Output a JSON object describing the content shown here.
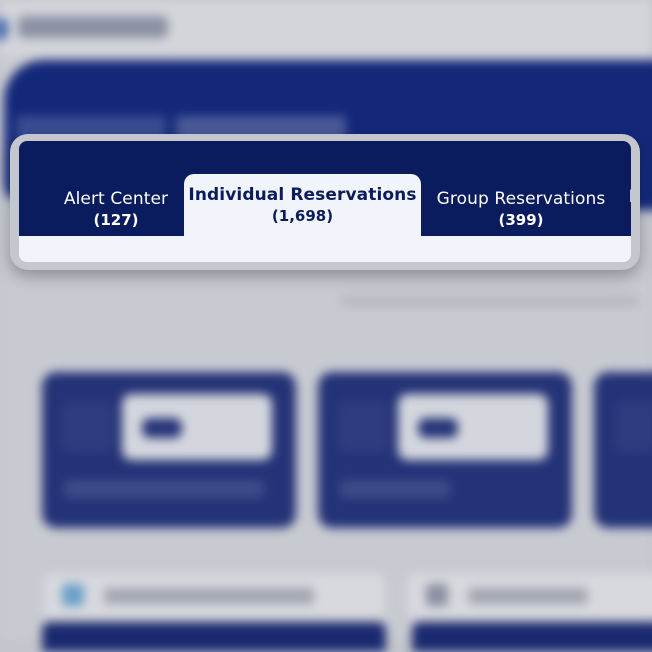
{
  "tabs": [
    {
      "label": "Alert Center",
      "count": "(127)",
      "active": false
    },
    {
      "label": "Individual Reservations",
      "count": "(1,698)",
      "active": true
    },
    {
      "label": "Group Reservations",
      "count": "(399)",
      "active": false
    },
    {
      "label": "N",
      "count": "",
      "active": false
    }
  ],
  "colors": {
    "tab_bar": "#0b1c5e",
    "active_tab_bg": "#f1f4fa",
    "active_tab_text": "#0b1c5e",
    "inactive_tab_text": "#ffffff"
  }
}
